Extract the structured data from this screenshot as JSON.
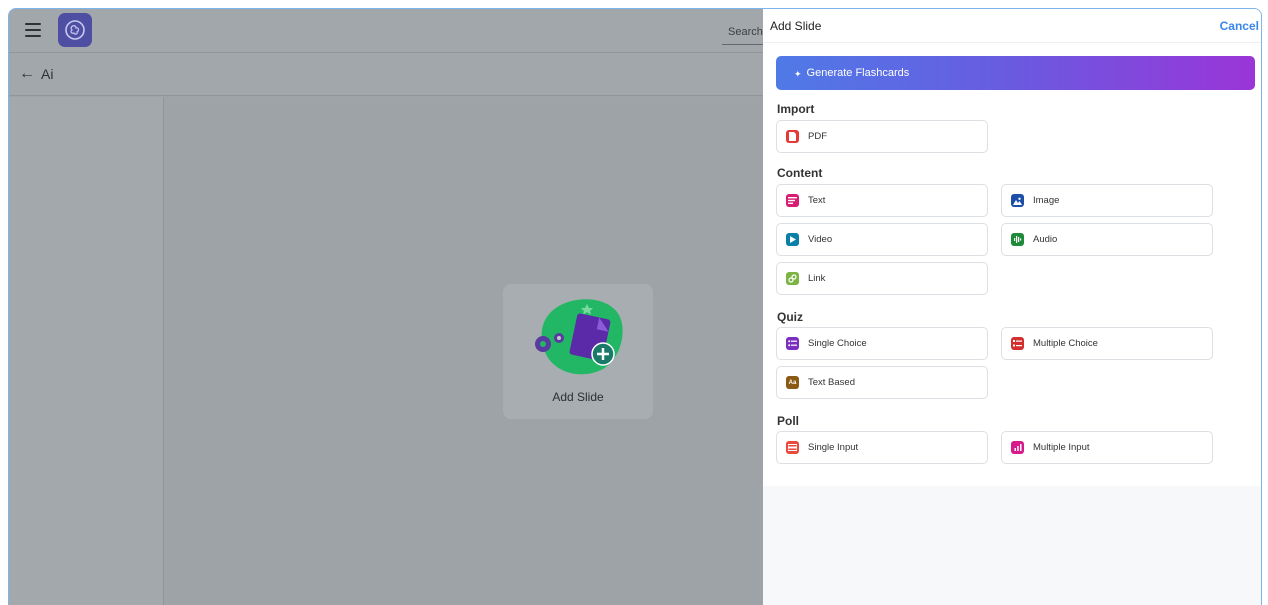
{
  "topbar": {
    "search_placeholder": "Search"
  },
  "breadcrumb": {
    "title": "Ai"
  },
  "canvas": {
    "add_slide_label": "Add Slide"
  },
  "drawer": {
    "title": "Add Slide",
    "cancel_label": "Cancel",
    "generate_label": "Generate Flashcards",
    "sections": {
      "import": "Import",
      "content": "Content",
      "quiz": "Quiz",
      "poll": "Poll"
    },
    "options": {
      "pdf": "PDF",
      "text": "Text",
      "image": "Image",
      "video": "Video",
      "audio": "Audio",
      "link": "Link",
      "single_choice": "Single Choice",
      "multiple_choice": "Multiple Choice",
      "text_based": "Text Based",
      "single_input": "Single Input",
      "multiple_input": "Multiple Input"
    }
  },
  "colors": {
    "accent": "#3a86e8",
    "gradient_start": "#4f7ae6",
    "gradient_end": "#9a35d8",
    "overlay": "#9da3a7"
  }
}
